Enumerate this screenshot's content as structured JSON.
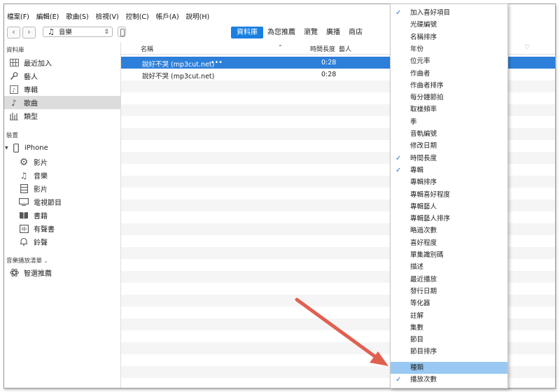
{
  "menubar": {
    "items": [
      "檔案(F)",
      "編輯(E)",
      "歌曲(S)",
      "檢視(V)",
      "控制(C)",
      "帳戶(A)",
      "說明(H)"
    ]
  },
  "toolbar": {
    "back_icon": "chevron-left-icon",
    "forward_icon": "chevron-right-icon",
    "media_kind": "音樂",
    "tabs": [
      {
        "label": "資料庫",
        "active": true
      },
      {
        "label": "為您推薦",
        "active": false
      },
      {
        "label": "瀏覽",
        "active": false
      },
      {
        "label": "廣播",
        "active": false
      },
      {
        "label": "商店",
        "active": false
      }
    ]
  },
  "sidebar": {
    "library_heading": "資料庫",
    "library_items": [
      {
        "label": "最近加入",
        "icon": "grid-icon"
      },
      {
        "label": "藝人",
        "icon": "microphone-icon"
      },
      {
        "label": "專輯",
        "icon": "album-icon"
      },
      {
        "label": "歌曲",
        "icon": "music-note-icon",
        "selected": true
      },
      {
        "label": "類型",
        "icon": "genre-icon"
      }
    ],
    "devices_heading": "裝置",
    "device_name": "iPhone",
    "device_items": [
      {
        "label": "影片",
        "icon": "gear-icon"
      },
      {
        "label": "音樂",
        "icon": "music-note-icon"
      },
      {
        "label": "影片",
        "icon": "film-icon"
      },
      {
        "label": "電視節目",
        "icon": "tv-icon"
      },
      {
        "label": "書籍",
        "icon": "book-icon"
      },
      {
        "label": "有聲書",
        "icon": "audiobook-icon"
      },
      {
        "label": "鈴聲",
        "icon": "bell-icon"
      }
    ],
    "playlists_heading": "音樂播放清單",
    "playlist_items": [
      {
        "label": "智選推薦",
        "icon": "atom-icon"
      }
    ]
  },
  "table": {
    "columns": {
      "name": "名稱",
      "time": "時間長度",
      "artist": "藝人"
    },
    "rows": [
      {
        "name": "說好不哭 (mp3cut.net)",
        "more": "•••",
        "time": "0:28",
        "selected": true
      },
      {
        "name": "說好不哭 (mp3cut.net)",
        "more": "",
        "time": "0:28",
        "selected": false
      }
    ]
  },
  "column_menu": {
    "items": [
      {
        "label": "加入喜好項目",
        "checked": true
      },
      {
        "label": "光碟編號",
        "checked": false
      },
      {
        "label": "名稱排序",
        "checked": false
      },
      {
        "label": "年份",
        "checked": false
      },
      {
        "label": "位元率",
        "checked": false
      },
      {
        "label": "作曲者",
        "checked": false
      },
      {
        "label": "作曲者排序",
        "checked": false
      },
      {
        "label": "每分鐘節拍",
        "checked": false
      },
      {
        "label": "取樣頻率",
        "checked": false
      },
      {
        "label": "季",
        "checked": false
      },
      {
        "label": "音軌編號",
        "checked": false
      },
      {
        "label": "修改日期",
        "checked": false
      },
      {
        "label": "時間長度",
        "checked": true
      },
      {
        "label": "專輯",
        "checked": true
      },
      {
        "label": "專輯排序",
        "checked": false
      },
      {
        "label": "專輯喜好程度",
        "checked": false
      },
      {
        "label": "專輯藝人",
        "checked": false
      },
      {
        "label": "專輯藝人排序",
        "checked": false
      },
      {
        "label": "略過次數",
        "checked": false
      },
      {
        "label": "喜好程度",
        "checked": false
      },
      {
        "label": "單集識別碼",
        "checked": false
      },
      {
        "label": "描述",
        "checked": false
      },
      {
        "label": "最近播放",
        "checked": false
      },
      {
        "label": "發行日期",
        "checked": false
      },
      {
        "label": "等化器",
        "checked": false
      },
      {
        "label": "註解",
        "checked": false
      },
      {
        "label": "集數",
        "checked": false
      },
      {
        "label": "節目",
        "checked": false
      },
      {
        "label": "節目排序",
        "checked": false
      },
      {
        "label": "種類",
        "checked": false,
        "highlighted": true
      },
      {
        "label": "播放次數",
        "checked": true
      }
    ]
  },
  "colors": {
    "accent": "#1a7fe0",
    "selection": "#2d7fd9",
    "menu_highlight": "#99c9f2",
    "check": "#2b6fd6",
    "arrow": "#e06050"
  }
}
